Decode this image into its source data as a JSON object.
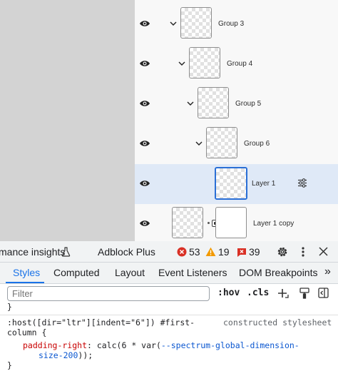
{
  "layers": [
    {
      "name": "Group 3",
      "expanded": true
    },
    {
      "name": "Group 4",
      "expanded": true
    },
    {
      "name": "Group 5",
      "expanded": true
    },
    {
      "name": "Group 6",
      "expanded": true
    },
    {
      "name": "Layer 1",
      "selected": true
    },
    {
      "name": "Layer 1 copy"
    }
  ],
  "devtools": {
    "truncated_tab": "mance insights",
    "adblock_tab": "Adblock Plus",
    "errors": "53",
    "warnings": "19",
    "issues": "39",
    "tabs": [
      "Styles",
      "Computed",
      "Layout",
      "Event Listeners",
      "DOM Breakpoints"
    ],
    "overflow_label": "»",
    "filter_placeholder": "Filter",
    "hov_label": ":hov",
    "cls_label": ".cls"
  },
  "styles_code": {
    "brace_prev": "}",
    "selector_line1": ":host([dir=\"ltr\"][indent=\"6\"]) #first-",
    "selector_line2": "column {",
    "source": "constructed stylesheet",
    "property": "padding-right",
    "value_prefix": ": calc(6 * var(",
    "var_part1": "--spectrum-global-dimension-",
    "var_part2": "size-200",
    "value_suffix": "));",
    "closing_brace": "}"
  },
  "colors": {
    "selection": "#dfe9f7",
    "accent": "#1a73e8",
    "error": "#d93025",
    "warning": "#f29900",
    "issue": "#d93025"
  }
}
